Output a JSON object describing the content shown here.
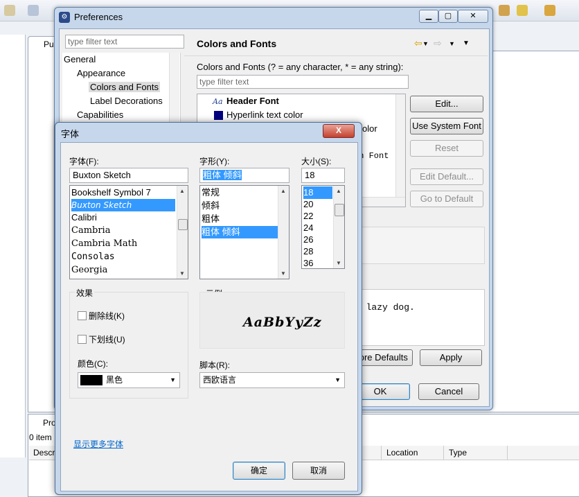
{
  "preferences": {
    "title": "Preferences",
    "filter_placeholder": "type filter text",
    "tree": [
      {
        "label": "General",
        "level": 0
      },
      {
        "label": "Appearance",
        "level": 1
      },
      {
        "label": "Colors and Fonts",
        "level": 2,
        "selected": true
      },
      {
        "label": "Label Decorations",
        "level": 2
      },
      {
        "label": "Capabilities",
        "level": 1
      }
    ],
    "page_title": "Colors and Fonts",
    "description": "Colors and Fonts (? = any character, * = any string):",
    "content_filter_placeholder": "type filter text",
    "items": [
      {
        "label": "Header Font",
        "bold": true,
        "icon": "font-aa-icon"
      },
      {
        "label": "Hyperlink text color",
        "icon": "color-swatch-icon",
        "color": "#000080"
      },
      {
        "label": "olor"
      },
      {
        "label": "on Font"
      }
    ],
    "buttons": {
      "edit": "Edit...",
      "use_system_font": "Use System Font",
      "reset": "Reset",
      "edit_default": "Edit Default...",
      "go_to_default": "Go to Default",
      "restore_defaults": "tore Defaults",
      "apply": "Apply",
      "ok": "OK",
      "cancel": "Cancel"
    },
    "preview_text": "e lazy dog."
  },
  "background": {
    "editor_tab": "Pu",
    "problems_tab": "Pro",
    "problems_count": "0 item",
    "columns": [
      "Descr",
      "Location",
      "Type"
    ]
  },
  "font_dialog": {
    "title": "字体",
    "close": "X",
    "font_label": "字体(F):",
    "font_value": "Buxton Sketch",
    "fonts": [
      "Bookshelf Symbol 7",
      "Buxton Sketch",
      "Calibri",
      "Cambria",
      "Cambria Math",
      "Consolas",
      "Georgia"
    ],
    "selected_font": "Buxton Sketch",
    "style_label": "字形(Y):",
    "style_value": "粗体 倾斜",
    "styles": [
      "常规",
      "倾斜",
      "粗体",
      "粗体 倾斜"
    ],
    "selected_style": "粗体 倾斜",
    "size_label": "大小(S):",
    "size_value": "18",
    "sizes": [
      "18",
      "20",
      "22",
      "24",
      "26",
      "28",
      "36"
    ],
    "selected_size": "18",
    "effects_label": "效果",
    "strikeout_label": "删除线(K)",
    "underline_label": "下划线(U)",
    "color_label": "颜色(C):",
    "color_value": "黑色",
    "color_swatch": "#000000",
    "sample_label": "示例",
    "sample_text": "AaBbYyZz",
    "script_label": "脚本(R):",
    "script_value": "西欧语言",
    "more_fonts": "显示更多字体",
    "ok": "确定",
    "cancel": "取消"
  },
  "colors": {
    "selection": "#3399ff",
    "title_bar": "#c6d7ec",
    "link": "#0066cc"
  }
}
